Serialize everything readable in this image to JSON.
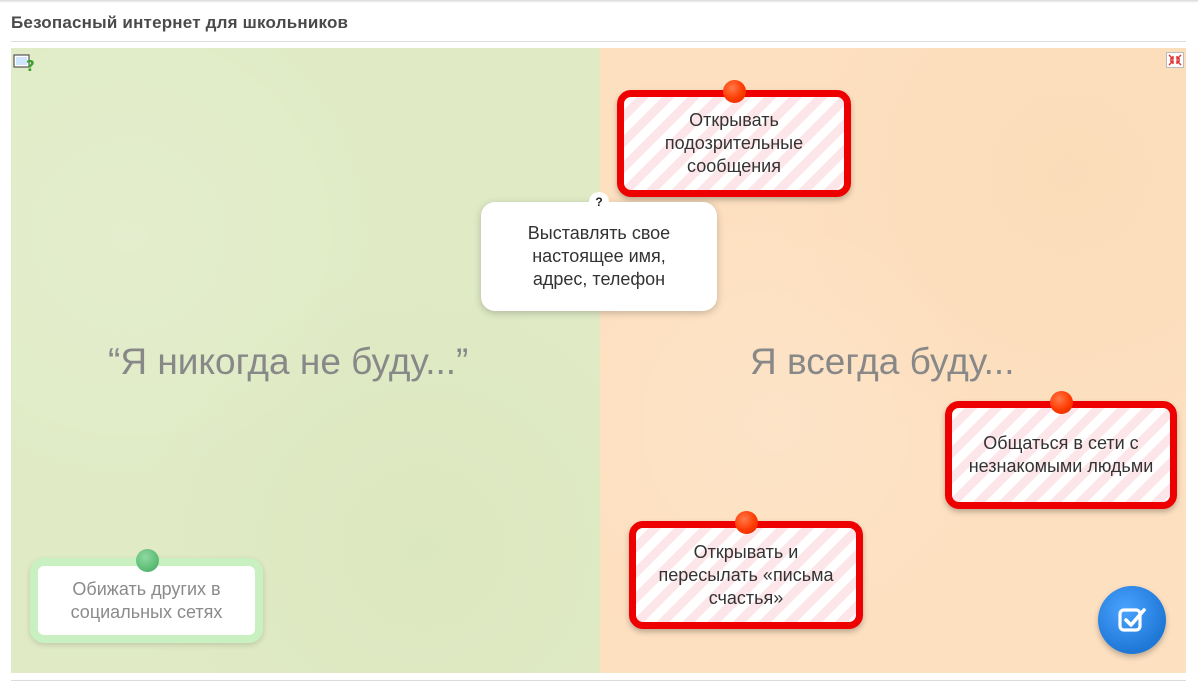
{
  "page": {
    "title": "Безопасный интернет для школьников"
  },
  "board": {
    "help_icon": "help-question-icon",
    "fullscreen_icon": "fullscreen-exit-icon",
    "zones": {
      "left": {
        "label": "“Я никогда не буду...”",
        "color": "#e0ebc6"
      },
      "right": {
        "label": "Я всегда буду...",
        "color": "#fde0c0"
      }
    },
    "cards": {
      "suspicious": "Открывать подозрительные сообщения",
      "name_address": "Выставлять свое настоящее имя, адрес, телефон",
      "unknown_people": "Общаться в сети с незнакомыми людьми",
      "chain_letters": "Открывать и пересылать «письма счастья»",
      "offend": "Обижать других в социальных сетях"
    },
    "question_mark": "?",
    "check_icon": "check-icon",
    "colors": {
      "incorrect_border": "#ee0000",
      "correct_border": "#c8f0c0",
      "check_button": "#1f78d6"
    }
  }
}
